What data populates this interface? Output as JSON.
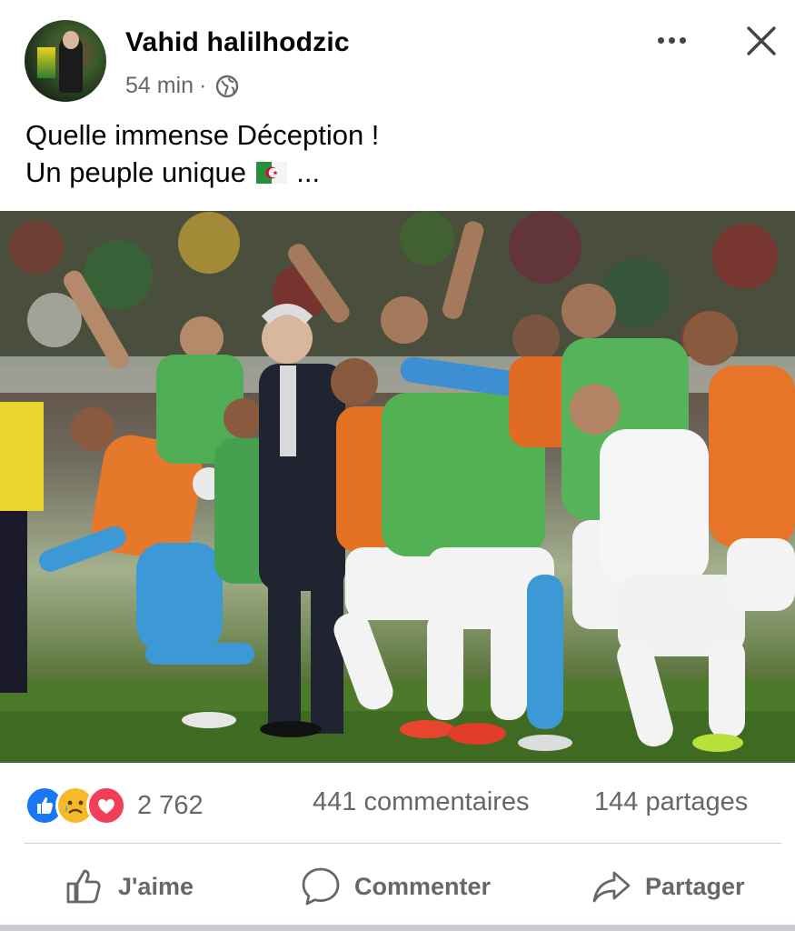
{
  "post": {
    "author": "Vahid halilhodzic",
    "time": "54 min",
    "separator": "·",
    "text_line1": "Quelle immense Déception !",
    "text_line2_prefix": "Un peuple unique ",
    "text_line2_suffix": " ..."
  },
  "stats": {
    "reaction_count": "2 762",
    "comments": "441 commentaires",
    "shares": "144 partages"
  },
  "actions": {
    "like": "J'aime",
    "comment": "Commenter",
    "share": "Partager"
  },
  "icons": [
    "more-icon",
    "close-icon",
    "globe-icon",
    "like-reaction-icon",
    "sad-reaction-icon",
    "love-reaction-icon",
    "thumbs-up-icon",
    "comment-icon",
    "share-icon"
  ],
  "colors": {
    "like_blue": "#1877f2",
    "love_red": "#f33e58",
    "sad_yellow": "#f7b928",
    "secondary_text": "#65676b"
  }
}
